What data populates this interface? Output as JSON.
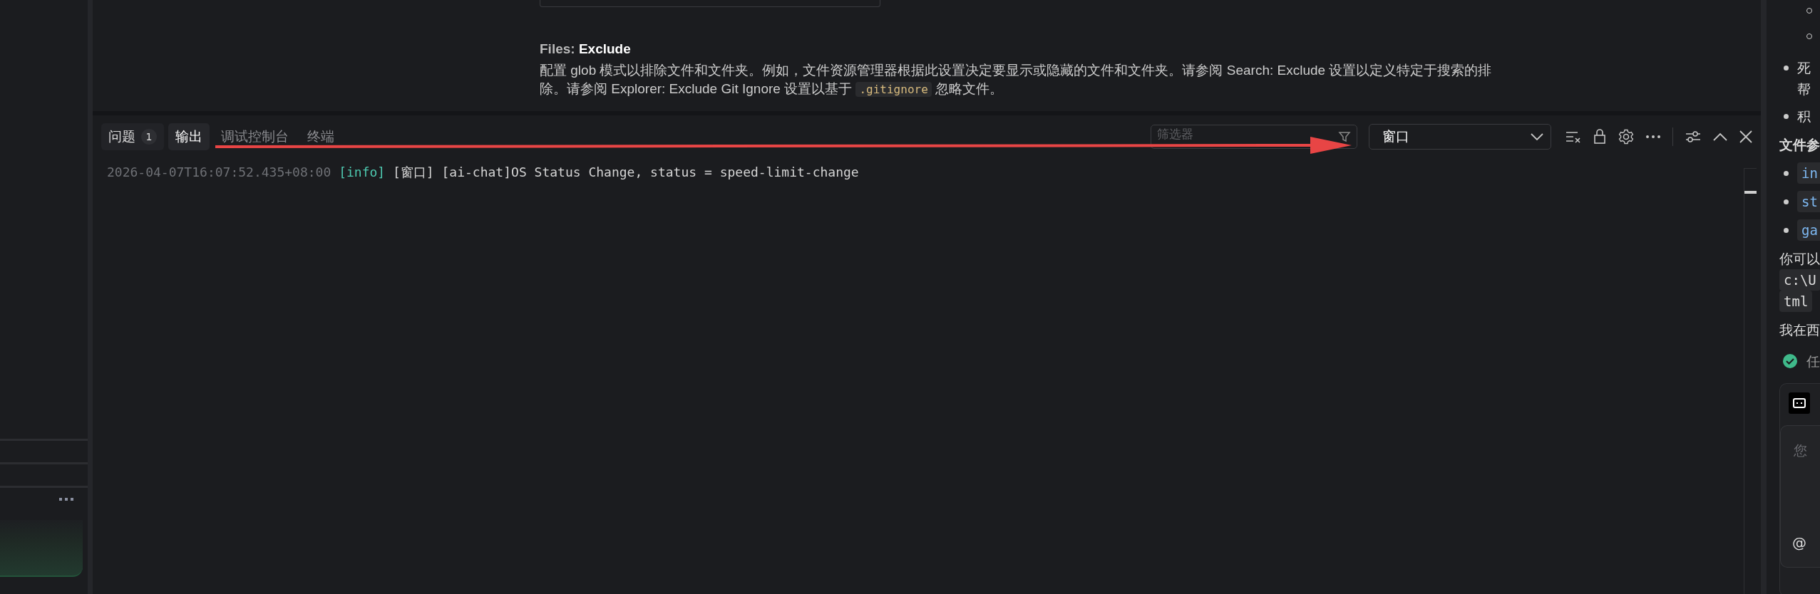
{
  "setting": {
    "category": "Files: ",
    "name": "Exclude",
    "description_before": "配置 glob 模式以排除文件和文件夹。例如，文件资源管理器根据此设置决定要显示或隐藏的文件和文件夹。请参阅 Search: Exclude 设置以定义特定于搜索的排除。请参阅 Explorer: Exclude Git Ignore 设置以基于 ",
    "description_code": ".gitignore",
    "description_after": " 忽略文件。"
  },
  "panel": {
    "tabs": [
      {
        "label": "问题",
        "badge": "1",
        "selected": false
      },
      {
        "label": "输出",
        "selected": true
      },
      {
        "label": "调试控制台",
        "selected": false
      },
      {
        "label": "终端",
        "selected": false
      }
    ],
    "filter": {
      "placeholder": "筛选器"
    },
    "channel": {
      "value": "窗口"
    },
    "output_lines": [
      {
        "timestamp": "2026-04-07T16:07:52.435+08:00",
        "level": "[info]",
        "message": "[窗口] [ai-chat]OS Status Change, status = speed-limit-change"
      }
    ]
  },
  "chat": {
    "items": [
      {
        "kind": "sub-bullet"
      },
      {
        "kind": "sub-bullet"
      },
      {
        "kind": "bullet",
        "text": "死帮"
      },
      {
        "kind": "bullet",
        "text": "积"
      },
      {
        "kind": "heading",
        "text": "文件参"
      },
      {
        "kind": "code-bullet",
        "text": "in"
      },
      {
        "kind": "code-bullet",
        "text": "st"
      },
      {
        "kind": "code-bullet",
        "text": "ga"
      },
      {
        "kind": "paragraph",
        "text": "你可以"
      },
      {
        "kind": "code",
        "text": "c:\\U"
      },
      {
        "kind": "code",
        "text": "tml"
      },
      {
        "kind": "paragraph",
        "text": "我在西"
      },
      {
        "kind": "status",
        "text": "任"
      }
    ],
    "input": {
      "placeholder": "您",
      "mention": "@"
    }
  }
}
